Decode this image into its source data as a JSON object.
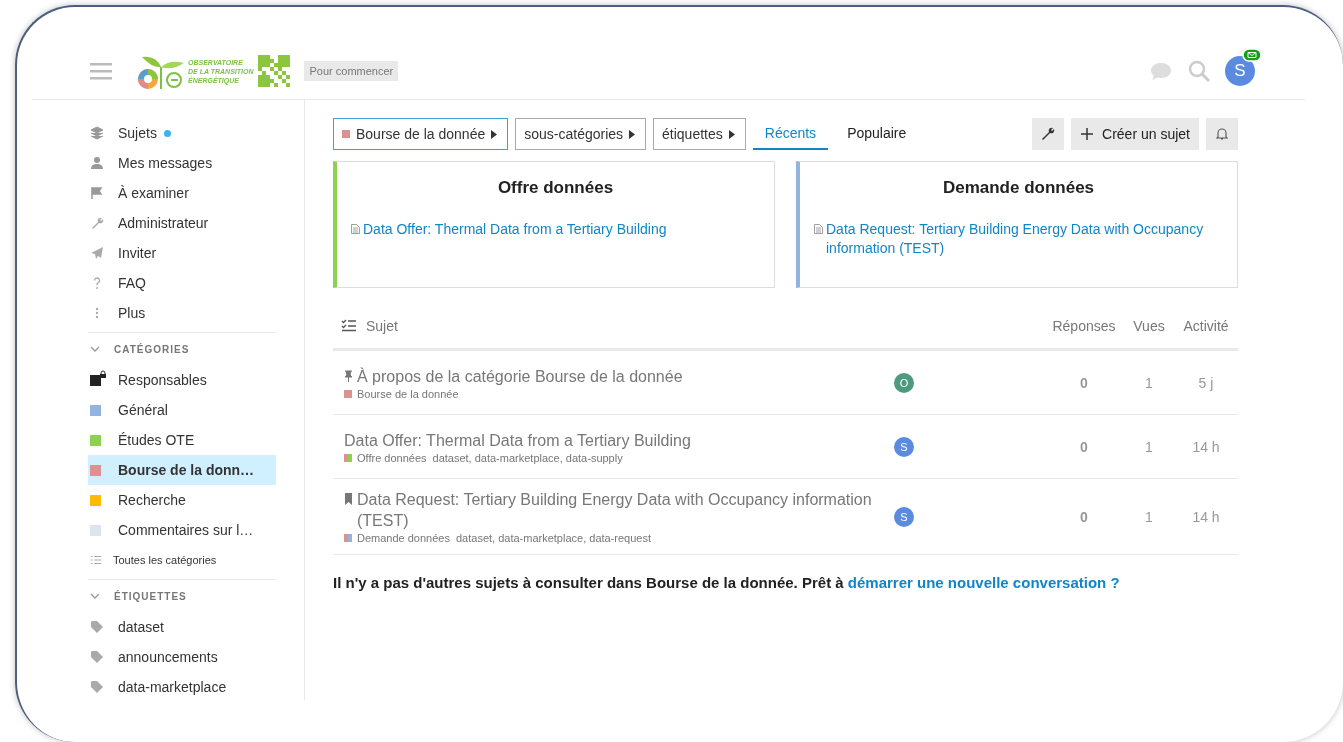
{
  "header": {
    "logo_lines": [
      "OBSERVATOIRE",
      "DE LA TRANSITION",
      "ÉNERGÉTIQUE"
    ],
    "start_button": "Pour commencer",
    "avatar": {
      "letter": "S",
      "color": "#5b8be0"
    },
    "has_message_badge": true
  },
  "sidebar": {
    "nav": [
      {
        "label": "Sujets",
        "unread": true
      },
      {
        "label": "Mes messages",
        "unread": false
      },
      {
        "label": "À examiner",
        "unread": false
      },
      {
        "label": "Administrateur",
        "unread": false
      },
      {
        "label": "Inviter",
        "unread": false
      },
      {
        "label": "FAQ",
        "unread": false
      },
      {
        "label": "Plus",
        "unread": false
      }
    ],
    "categories_title": "CATÉGORIES",
    "categories_expanded": true,
    "categories": [
      {
        "label": "Responsables",
        "color": "#222222",
        "locked": true,
        "selected": false
      },
      {
        "label": "Général",
        "color": "#92b4de",
        "locked": false,
        "selected": false
      },
      {
        "label": "Études OTE",
        "color": "#8cd150",
        "locked": false,
        "selected": false
      },
      {
        "label": "Bourse de la donn…",
        "color": "#de9191",
        "locked": false,
        "selected": true
      },
      {
        "label": "Recherche",
        "color": "#ffbb00",
        "locked": false,
        "selected": false
      },
      {
        "label": "Commentaires sur l…",
        "color": "#dbe4f0",
        "locked": false,
        "selected": false
      }
    ],
    "all_categories": "Toutes les catégories",
    "tags_title": "ÉTIQUETTES",
    "tags_expanded": true,
    "tags": [
      "dataset",
      "announcements",
      "data-marketplace"
    ]
  },
  "filters": {
    "category": {
      "label": "Bourse de la donnée",
      "color": "#de9191"
    },
    "subcategories": "sous-catégories",
    "tags": "étiquettes",
    "tabs": [
      {
        "label": "Récents",
        "selected": true
      },
      {
        "label": "Populaire",
        "selected": false
      }
    ],
    "create_button": "Créer un sujet"
  },
  "featured": [
    {
      "title": "Offre données",
      "color": "#8cd150",
      "link": "Data Offer: Thermal Data from a Tertiary Building"
    },
    {
      "title": "Demande données",
      "color": "#92b4de",
      "link": "Data Request: Tertiary Building Energy Data with Occupancy information (TEST)"
    }
  ],
  "table": {
    "columns": [
      "Sujet",
      "Réponses",
      "Vues",
      "Activité"
    ],
    "rows": [
      {
        "kind": "pinned",
        "title": "À propos de la catégorie Bourse de la donnée",
        "category": "Bourse de la donnée",
        "category_swatches": [
          {
            "color": "#de9191"
          }
        ],
        "tags": "",
        "avatar": {
          "letter": "O",
          "color": "#4e9a7e"
        },
        "replies": "0",
        "views": "1",
        "activity": "5 j"
      },
      {
        "kind": "plain",
        "title": "Data Offer: Thermal Data from a Tertiary Building",
        "category": "Offre données",
        "category_swatches": [
          {
            "color": "#de9191"
          },
          {
            "color": "#8cd150"
          }
        ],
        "tags": "dataset, data-marketplace, data-supply",
        "avatar": {
          "letter": "S",
          "color": "#5b8be0"
        },
        "replies": "0",
        "views": "1",
        "activity": "14 h"
      },
      {
        "kind": "bookmarked",
        "title": "Data Request: Tertiary Building Energy Data with Occupancy information (TEST)",
        "category": "Demande données",
        "category_swatches": [
          {
            "color": "#de9191"
          },
          {
            "color": "#92b4de"
          }
        ],
        "tags": "dataset, data-marketplace, data-request",
        "avatar": {
          "letter": "S",
          "color": "#5b8be0"
        },
        "replies": "0",
        "views": "1",
        "activity": "14 h"
      }
    ]
  },
  "footer": {
    "text": "Il n'y a pas d'autres sujets à consulter dans Bourse de la donnée. Prêt à ",
    "link": "démarrer une nouvelle conversation ?"
  }
}
